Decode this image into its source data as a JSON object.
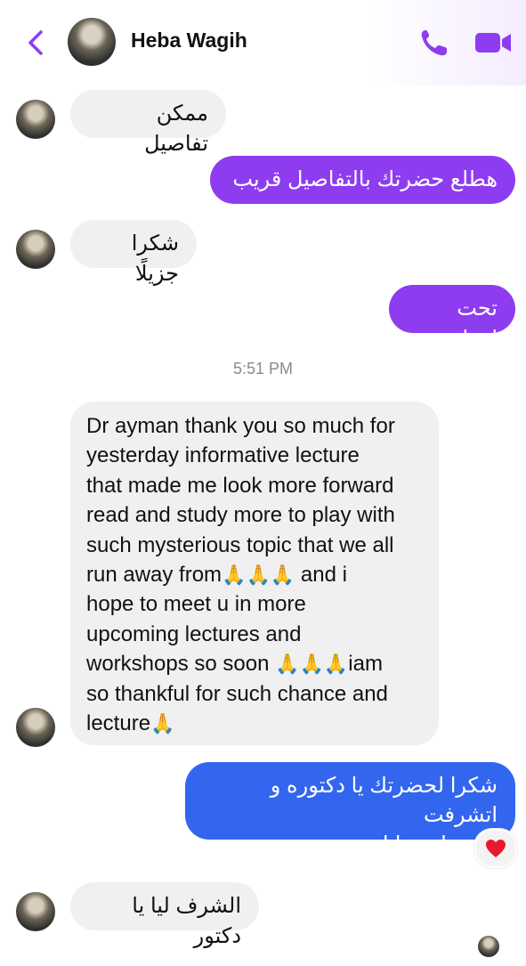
{
  "header": {
    "contact_name": "Heba Wagih",
    "back_icon": "chevron-left-icon",
    "call_icon": "phone-icon",
    "video_icon": "video-camera-icon",
    "accent_color": "#8e3cf0"
  },
  "messages": {
    "m1": "ممكن تفاصيل",
    "m2": "هطلع حضرتك بالتفاصيل قريب",
    "m3": "شكرا جزيلًا",
    "m4": "تحت امرك",
    "timestamp": "5:51 PM",
    "m5_line1": "Dr ayman thank you so much for",
    "m5_line2": "yesterday informative lecture",
    "m5_line3": "that made me look more forward",
    "m5_line4": "read and study more to play with",
    "m5_line5": "such mysterious topic that we all",
    "m5_line6a": "run away from",
    "m5_line6b": " and i",
    "m5_line7": "hope to meet u in more",
    "m5_line8": "upcoming lectures and",
    "m5_line9a": "workshops so soon ",
    "m5_line9b": "iam",
    "m5_line10": "so thankful for such chance and",
    "m5_line11": "lecture",
    "pray3": "🙏🙏🙏",
    "pray1": "🙏",
    "m6_line1": "شكرا لحضرتك يا دكتوره و اتشرفت",
    "m6_line2": "بوجودك معانا",
    "m6_reaction": "❤️",
    "m7": "الشرف ليا يا دكتور"
  },
  "colors": {
    "outgoing_purple": "#8e3cf0",
    "outgoing_blue": "#3366ee",
    "incoming_gray": "#f0f0f0"
  }
}
